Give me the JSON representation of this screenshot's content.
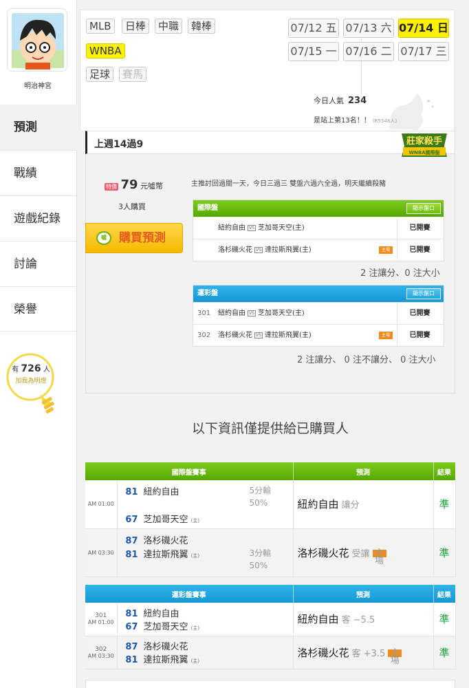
{
  "sidebar": {
    "user_name": "明治神宮",
    "nav": [
      "預測",
      "戰績",
      "遊戲紀錄",
      "討論",
      "榮譽"
    ],
    "fans_prefix": "有",
    "fans_count": "726",
    "fans_suffix": "人",
    "fans_label": "加我為明燈"
  },
  "sports": {
    "row1": [
      "MLB",
      "日棒",
      "中職",
      "韓棒"
    ],
    "row2": [
      "WNBA"
    ],
    "row3": [
      "足球",
      "賽馬"
    ]
  },
  "dates": [
    {
      "d": "07/12",
      "w": "五"
    },
    {
      "d": "07/13",
      "w": "六"
    },
    {
      "d": "07/14",
      "w": "日"
    },
    {
      "d": "07/15",
      "w": "一"
    },
    {
      "d": "07/16",
      "w": "二"
    },
    {
      "d": "07/17",
      "w": "三"
    }
  ],
  "popularity": {
    "label": "今日人氣",
    "value": "234"
  },
  "rank_text": "是站上第13名！！",
  "rank_small": "(R5548人)",
  "panel": {
    "title": "上週14過9",
    "badge_line1": "莊家殺手",
    "badge_line2": "WNBA國際盤",
    "price_tag": "特價",
    "price": "79",
    "price_unit": "元噓幣",
    "buyers": "3人購買",
    "buy_button": "購買預測",
    "buy_icon": "噓",
    "description": "主推討回過關一天，今日三過三 雙盤六過六全過，明天繼續殺豬"
  },
  "intl_table": {
    "header": "國際盤",
    "show_button": "顯示盤口",
    "rows": [
      {
        "num": "",
        "away": "紐約自由",
        "home": "芝加哥天空(主)",
        "host": false,
        "status": "已開賽"
      },
      {
        "num": "",
        "away": "洛杉磯火花",
        "home": "達拉斯飛翼(主)",
        "host": true,
        "status": "已開賽"
      }
    ],
    "summary": "2 注讓分、0 注大小"
  },
  "lottery_table": {
    "header": "運彩盤",
    "show_button": "顯示盤口",
    "rows": [
      {
        "num": "301",
        "away": "紐約自由",
        "home": "芝加哥天空(主)",
        "host": false,
        "status": "已開賽"
      },
      {
        "num": "302",
        "away": "洛杉磯火花",
        "home": "達拉斯飛翼(主)",
        "host": true,
        "status": "已開賽"
      }
    ],
    "summary": "2 注讓分、 0 注不讓分、 0 注大小"
  },
  "vs_label": "VS",
  "host_label": "主場",
  "info_only": "以下資訊僅提供給已購買人",
  "results_intl": {
    "headers": [
      "國際盤賽事",
      "預測",
      "結果"
    ],
    "games": [
      {
        "time": "AM 01:00",
        "s1": "81",
        "t1": "紐約自由",
        "s2": "67",
        "t2": "芝加哥天空",
        "host_mark": "(主)",
        "odds1": "5分輸",
        "odds2": "50%",
        "pick": "紐約自由",
        "pick_type": "讓分",
        "host": false,
        "result": "準"
      },
      {
        "time": "AM 03:30",
        "s1": "87",
        "t1": "洛杉磯火花",
        "s2": "81",
        "t2": "達拉斯飛翼",
        "host_mark": "(主)",
        "odds1": "3分輸",
        "odds2": "50%",
        "pick": "洛杉磯火花",
        "pick_type": "受讓",
        "host": true,
        "result": "準"
      }
    ]
  },
  "results_lottery": {
    "headers": [
      "運彩盤賽事",
      "預測",
      "結果"
    ],
    "games": [
      {
        "num": "301",
        "time": "AM 01:00",
        "s1": "81",
        "t1": "紐約自由",
        "s2": "67",
        "t2": "芝加哥天空",
        "host_mark": "(主)",
        "pick": "紐約自由",
        "pick_type": "客 −5.5",
        "host": false,
        "result": "準"
      },
      {
        "num": "302",
        "time": "AM 03:30",
        "s1": "87",
        "t1": "洛杉磯火花",
        "s2": "81",
        "t2": "達拉斯飛翼",
        "host_mark": "(主)",
        "pick": "洛杉磯火花",
        "pick_type": "客 +3.5",
        "host": true,
        "result": "準"
      }
    ]
  },
  "colors": {
    "accent_green": "#6cbf10",
    "accent_blue": "#22a3dc",
    "result_green": "#14a63b",
    "highlight_yellow": "#fff200",
    "score_blue": "#1a5aa8"
  }
}
